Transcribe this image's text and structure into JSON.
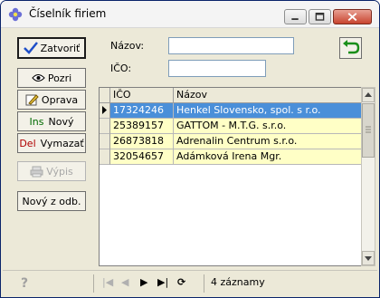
{
  "window": {
    "title": "Číselník firiem",
    "buttons": {
      "minimize": "minimize",
      "maximize": "maximize",
      "close": "close"
    }
  },
  "toolbar": {
    "zatvorit": "Zatvoriť",
    "pozri": "Pozri",
    "oprava": "Oprava",
    "novy_prefix": "Ins",
    "novy": "Nový",
    "vymazat_prefix": "Del",
    "vymazat": "Vymazať",
    "vypis": "Výpis",
    "novy_z_odb": "Nový z odb."
  },
  "form": {
    "nazov_label": "Názov:",
    "nazov_value": "",
    "ico_label": "IČO:",
    "ico_value": ""
  },
  "grid": {
    "columns": [
      "IČO",
      "Názov"
    ],
    "rows": [
      {
        "ico": "17324246",
        "nazov": "Henkel Slovensko, spol. s r.o.",
        "selected": true
      },
      {
        "ico": "25389157",
        "nazov": "GATTOM - M.T.G. s.r.o.",
        "selected": false
      },
      {
        "ico": "26873818",
        "nazov": "Adrenalin Centrum s.r.o.",
        "selected": false
      },
      {
        "ico": "32054657",
        "nazov": "Adámková Irena Mgr.",
        "selected": false
      }
    ]
  },
  "status": {
    "help": "?",
    "nav_first": "|◀",
    "nav_prev": "◀",
    "nav_next": "▶",
    "nav_last": "▶|",
    "nav_refresh": "⟳",
    "count": "4 záznamy"
  },
  "colors": {
    "selection": "#4a8fd9",
    "row_bg": "#ffffc6",
    "title_bar": "#f4f4f4"
  }
}
